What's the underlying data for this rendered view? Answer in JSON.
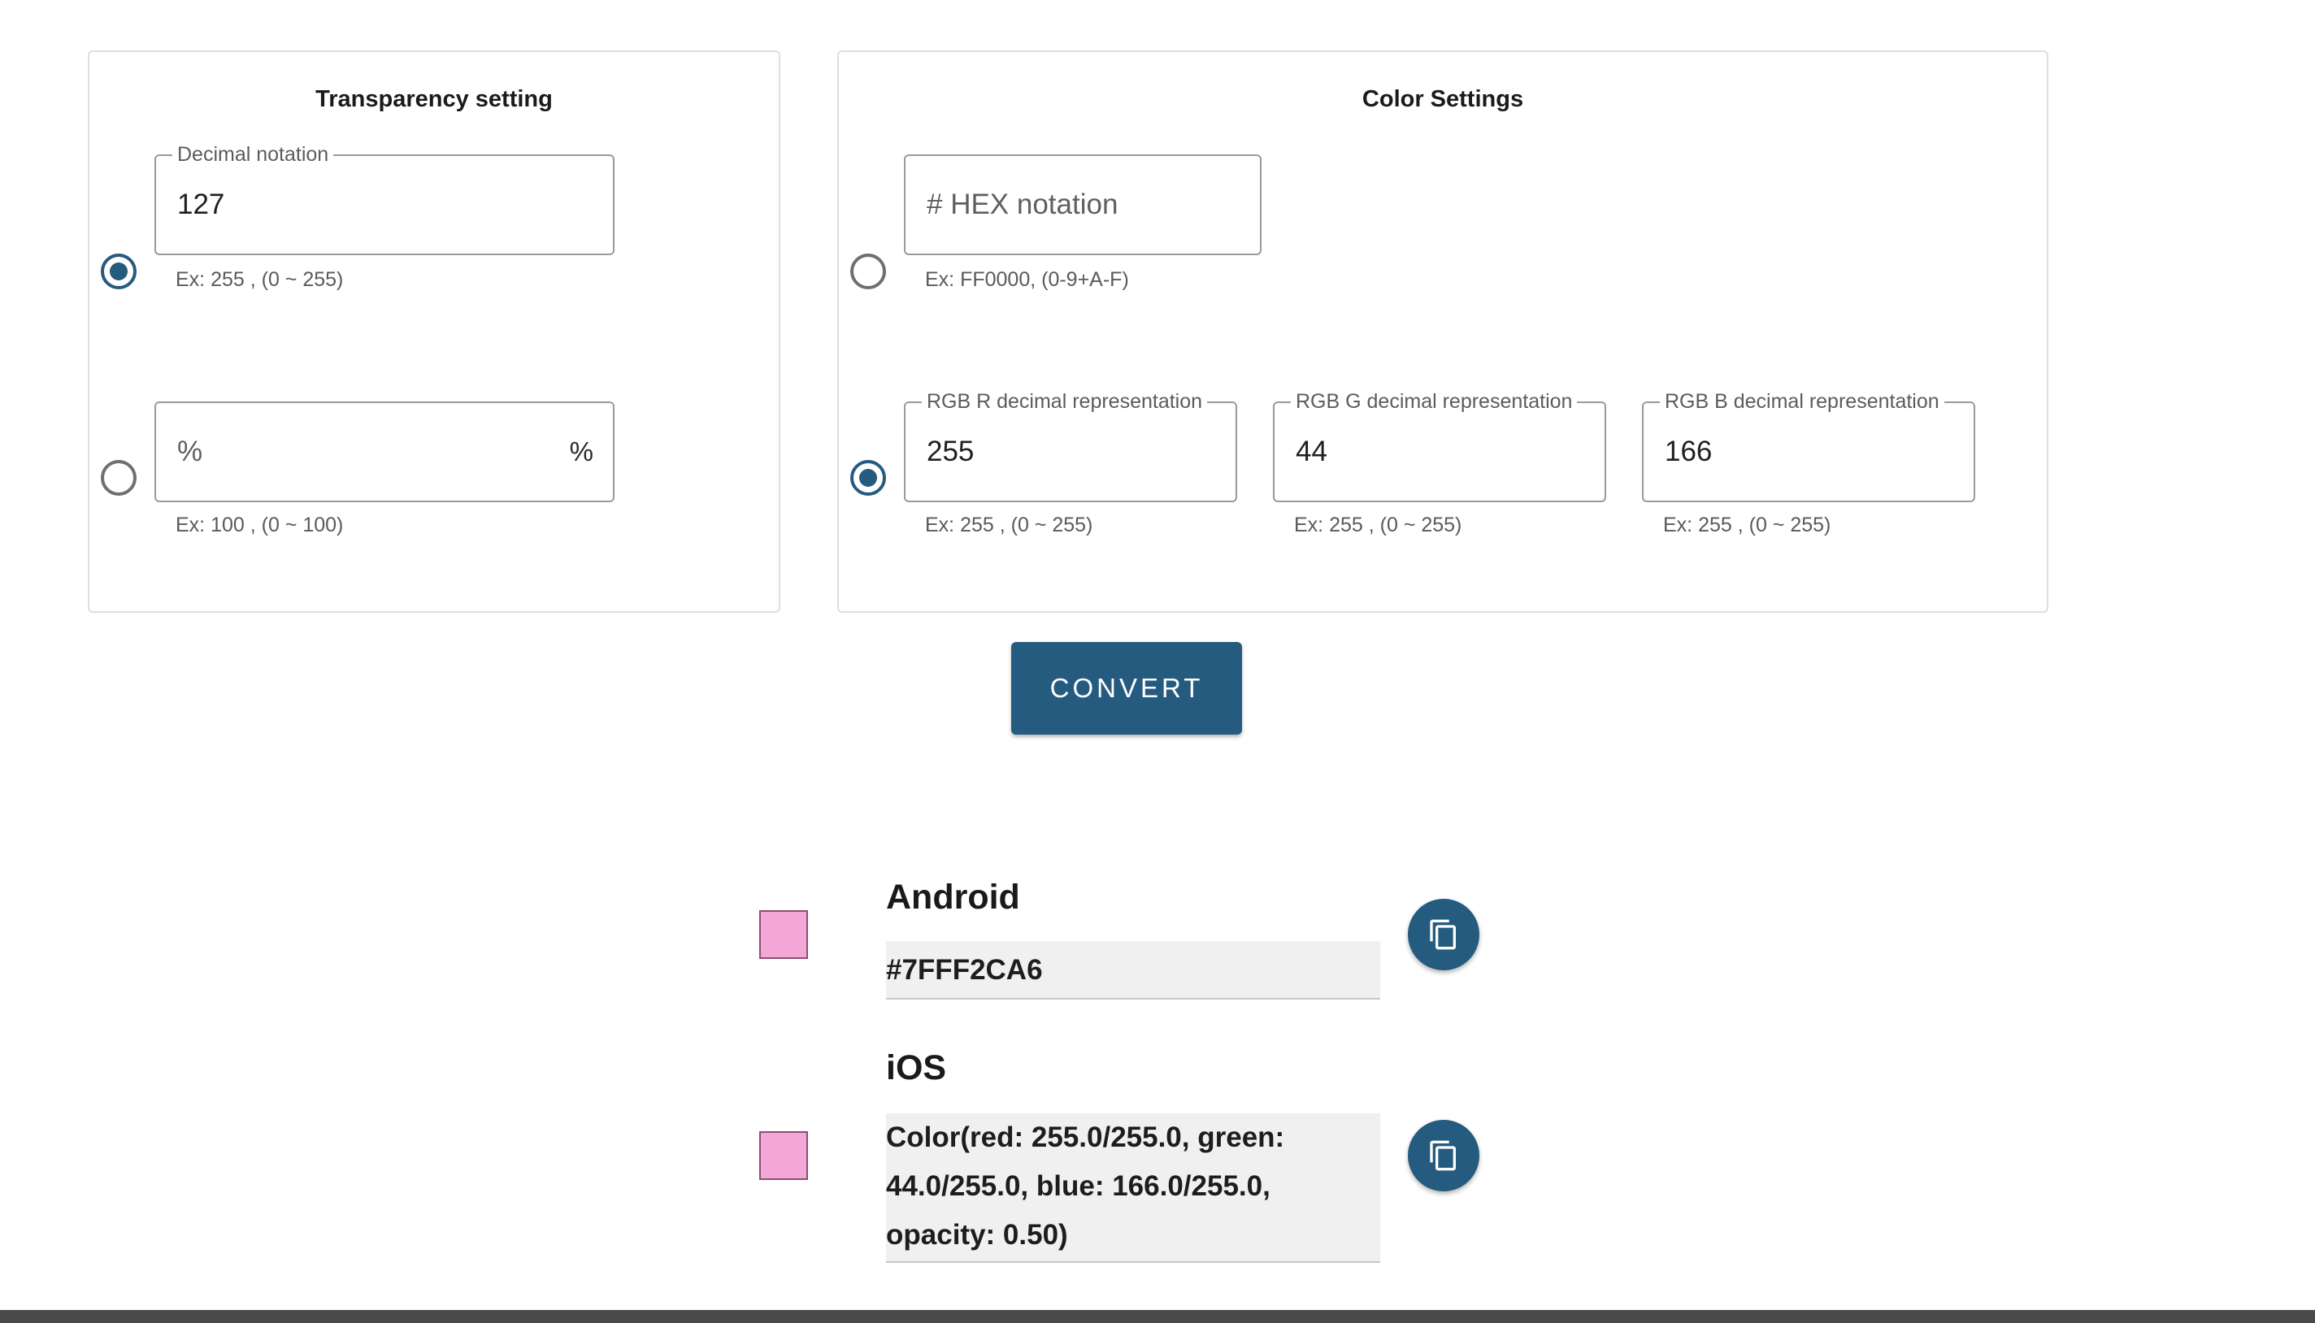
{
  "transparency": {
    "title": "Transparency setting",
    "decimal": {
      "label": "Decimal notation",
      "value": "127",
      "helper": "Ex: 255 , (0 ~ 255)",
      "selected": true
    },
    "percent": {
      "placeholder": "%",
      "suffix": "%",
      "helper": "Ex: 100 , (0 ~ 100)",
      "selected": false
    }
  },
  "color": {
    "title": "Color Settings",
    "hex": {
      "placeholder": "# HEX notation",
      "helper": "Ex: FF0000, (0-9+A-F)",
      "selected": false
    },
    "rgb": {
      "selected": true,
      "r": {
        "label": "RGB R decimal representation",
        "value": "255",
        "helper": "Ex: 255 , (0 ~ 255)"
      },
      "g": {
        "label": "RGB G decimal representation",
        "value": "44",
        "helper": "Ex: 255 , (0 ~ 255)"
      },
      "b": {
        "label": "RGB B decimal representation",
        "value": "166",
        "helper": "Ex: 255 , (0 ~ 255)"
      }
    }
  },
  "convert_label": "CONVERT",
  "results": {
    "swatch_color": "#F4A6D7",
    "android": {
      "title": "Android",
      "value": "#7FFF2CA6",
      "copy_icon": "copy-icon"
    },
    "ios": {
      "title": "iOS",
      "value_lines": [
        "Color(red: 255.0/255.0, green:",
        "44.0/255.0, blue: 166.0/255.0,",
        "opacity: 0.50)"
      ],
      "copy_icon": "copy-icon"
    }
  },
  "theme": {
    "accent": "#255B7F"
  }
}
